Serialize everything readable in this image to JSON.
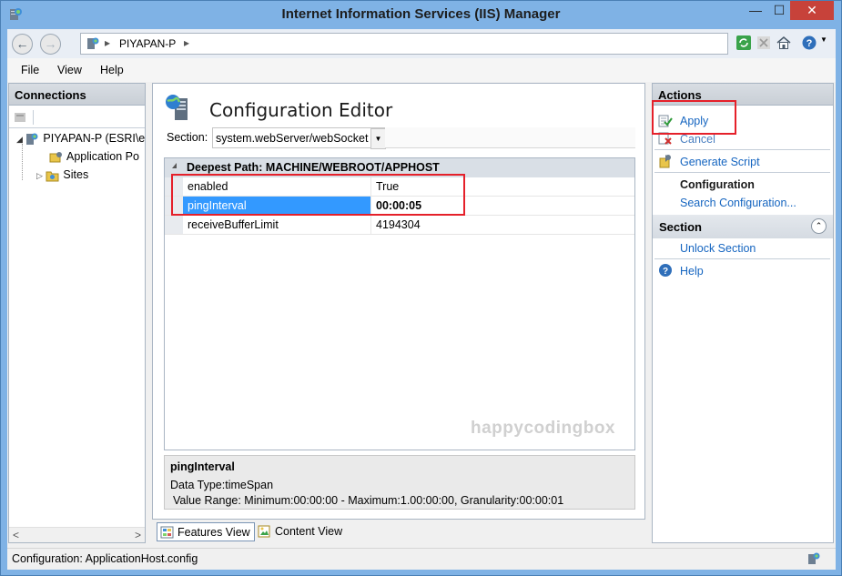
{
  "window": {
    "title": "Internet Information Services (IIS) Manager",
    "min_glyph": "—",
    "max_glyph": "☐",
    "close_glyph": "✕"
  },
  "address": {
    "back_glyph": "←",
    "forward_glyph": "→",
    "separator": "▸",
    "path": "PIYAPAN-P"
  },
  "menu": {
    "items": [
      "File",
      "View",
      "Help"
    ]
  },
  "connections": {
    "header": "Connections",
    "tree": [
      {
        "label": "PIYAPAN-P (ESRI\\e",
        "icon": "server-icon",
        "expander": "◢"
      },
      {
        "label": "Application Po",
        "icon": "app-pool-icon"
      },
      {
        "label": "Sites",
        "icon": "folder-icon",
        "expander": "▷"
      }
    ],
    "scroll_left": "<",
    "scroll_right": ">"
  },
  "editor": {
    "title": "Configuration Editor",
    "section_label": "Section:",
    "section_value": "system.webServer/webSocket",
    "section_arrow": "▼",
    "group_title": "Deepest Path: MACHINE/WEBROOT/APPHOST",
    "rows": [
      {
        "name": "enabled",
        "value": "True"
      },
      {
        "name": "pingInterval",
        "value": "00:00:05"
      },
      {
        "name": "receiveBufferLimit",
        "value": "4194304"
      }
    ],
    "watermark": "happycodingbox",
    "details": {
      "title": "pingInterval",
      "data_type": "Data Type:timeSpan",
      "value_range": "Value Range: Minimum:00:00:00 - Maximum:1.00:00:00, Granularity:00:00:01"
    }
  },
  "view_tabs": {
    "features": "Features View",
    "content": "Content View"
  },
  "actions": {
    "header": "Actions",
    "apply": "Apply",
    "cancel": "Cancel",
    "generate_script": "Generate Script",
    "configuration_header": "Configuration",
    "search_configuration": "Search Configuration...",
    "section_header": "Section",
    "collapse_glyph": "⌃",
    "unlock_section": "Unlock Section",
    "help": "Help"
  },
  "status": {
    "text": "Configuration: ApplicationHost.config"
  },
  "colors": {
    "selection": "#3399ff",
    "link": "#1565c0",
    "annotation": "#e5202a",
    "close_button": "#c7423a"
  }
}
